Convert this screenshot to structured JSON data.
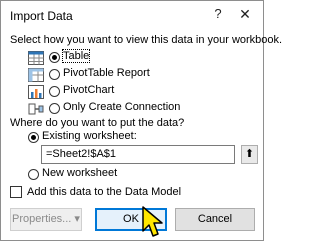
{
  "dialog": {
    "title": "Import Data",
    "help_icon": "?",
    "close_icon": "✕",
    "select_prompt": "Select how you want to view this data in your workbook.",
    "view_options": [
      {
        "label": "Table",
        "icon": "table-icon",
        "checked": true
      },
      {
        "label": "PivotTable Report",
        "icon": "pivottable-icon",
        "checked": false
      },
      {
        "label": "PivotChart",
        "icon": "pivotchart-icon",
        "checked": false
      },
      {
        "label": "Only Create Connection",
        "icon": "connection-icon",
        "checked": false
      }
    ],
    "put_prompt": "Where do you want to put the data?",
    "location_options": [
      {
        "label": "Existing worksheet:",
        "checked": true
      },
      {
        "label": "New worksheet",
        "checked": false
      }
    ],
    "range_value": "=Sheet2!$A$1",
    "collapse_icon": "⬆",
    "data_model_label": "Add this data to the Data Model",
    "data_model_checked": false,
    "properties_label": "Properties...",
    "properties_arrow": "▾",
    "ok_label": "OK",
    "cancel_label": "Cancel"
  },
  "colors": {
    "accent": "#0078d7",
    "cursor_fill": "#ffe600"
  }
}
